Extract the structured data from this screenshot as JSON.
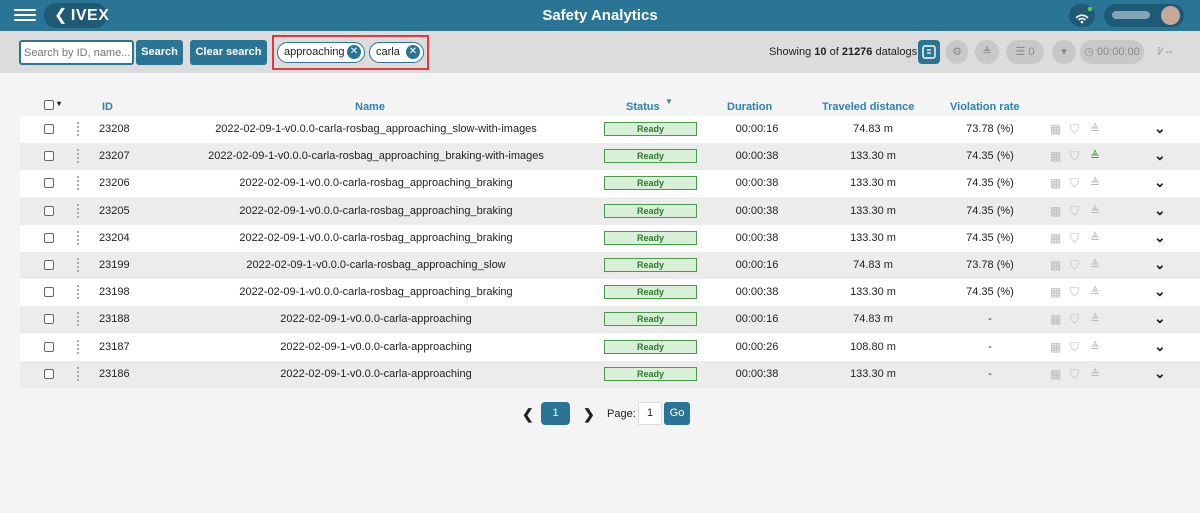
{
  "header": {
    "title": "Safety Analytics",
    "logo_text": "IVEX",
    "logo_chevron": "❮"
  },
  "toolbar": {
    "search_placeholder": "Search by ID, name...",
    "search_label": "Search",
    "clear_label": "Clear search",
    "tags": [
      {
        "label": "approaching",
        "remove_glyph": "✕"
      },
      {
        "label": "carla",
        "remove_glyph": "✕"
      }
    ],
    "showing_prefix": "Showing",
    "showing_count": "10",
    "showing_of": "of",
    "showing_total": "21276",
    "showing_suffix": "datalogs",
    "checklist_count": "0",
    "timer": "00:00:00",
    "dashes": "--"
  },
  "table": {
    "columns": [
      "ID",
      "Name",
      "Status",
      "Duration",
      "Traveled distance",
      "Violation rate"
    ],
    "rows": [
      {
        "id": "23208",
        "name": "2022-02-09-1-v0.0.0-carla-rosbag_approaching_slow-with-images",
        "status": "Ready",
        "duration": "00:00:16",
        "distance": "74.83 m",
        "violation": "73.78 (%)",
        "cone_active": false
      },
      {
        "id": "23207",
        "name": "2022-02-09-1-v0.0.0-carla-rosbag_approaching_braking-with-images",
        "status": "Ready",
        "duration": "00:00:38",
        "distance": "133.30 m",
        "violation": "74.35 (%)",
        "cone_active": true
      },
      {
        "id": "23206",
        "name": "2022-02-09-1-v0.0.0-carla-rosbag_approaching_braking",
        "status": "Ready",
        "duration": "00:00:38",
        "distance": "133.30 m",
        "violation": "74.35 (%)",
        "cone_active": false
      },
      {
        "id": "23205",
        "name": "2022-02-09-1-v0.0.0-carla-rosbag_approaching_braking",
        "status": "Ready",
        "duration": "00:00:38",
        "distance": "133.30 m",
        "violation": "74.35 (%)",
        "cone_active": false
      },
      {
        "id": "23204",
        "name": "2022-02-09-1-v0.0.0-carla-rosbag_approaching_braking",
        "status": "Ready",
        "duration": "00:00:38",
        "distance": "133.30 m",
        "violation": "74.35 (%)",
        "cone_active": false
      },
      {
        "id": "23199",
        "name": "2022-02-09-1-v0.0.0-carla-rosbag_approaching_slow",
        "status": "Ready",
        "duration": "00:00:16",
        "distance": "74.83 m",
        "violation": "73.78 (%)",
        "cone_active": false
      },
      {
        "id": "23198",
        "name": "2022-02-09-1-v0.0.0-carla-rosbag_approaching_braking",
        "status": "Ready",
        "duration": "00:00:38",
        "distance": "133.30 m",
        "violation": "74.35 (%)",
        "cone_active": false
      },
      {
        "id": "23188",
        "name": "2022-02-09-1-v0.0.0-carla-approaching",
        "status": "Ready",
        "duration": "00:00:16",
        "distance": "74.83 m",
        "violation": "-",
        "cone_active": false
      },
      {
        "id": "23187",
        "name": "2022-02-09-1-v0.0.0-carla-approaching",
        "status": "Ready",
        "duration": "00:00:26",
        "distance": "108.80 m",
        "violation": "-",
        "cone_active": false
      },
      {
        "id": "23186",
        "name": "2022-02-09-1-v0.0.0-carla-approaching",
        "status": "Ready",
        "duration": "00:00:38",
        "distance": "133.30 m",
        "violation": "-",
        "cone_active": false
      }
    ]
  },
  "pagination": {
    "current_page": "1",
    "page_label": "Page:",
    "page_input": "1",
    "go_label": "Go",
    "prev_glyph": "❮",
    "next_glyph": "❯"
  },
  "icons": {
    "map": "▦",
    "shield": "⛉",
    "cone": "≜",
    "expand": "⌄"
  },
  "colors": {
    "primary": "#2a7596",
    "header": "#2a7596",
    "highlight_border": "#e0393e",
    "ready_bg": "#d8f0d8",
    "ready_text": "#2d7a2d",
    "cone_active": "#3aa63a"
  }
}
